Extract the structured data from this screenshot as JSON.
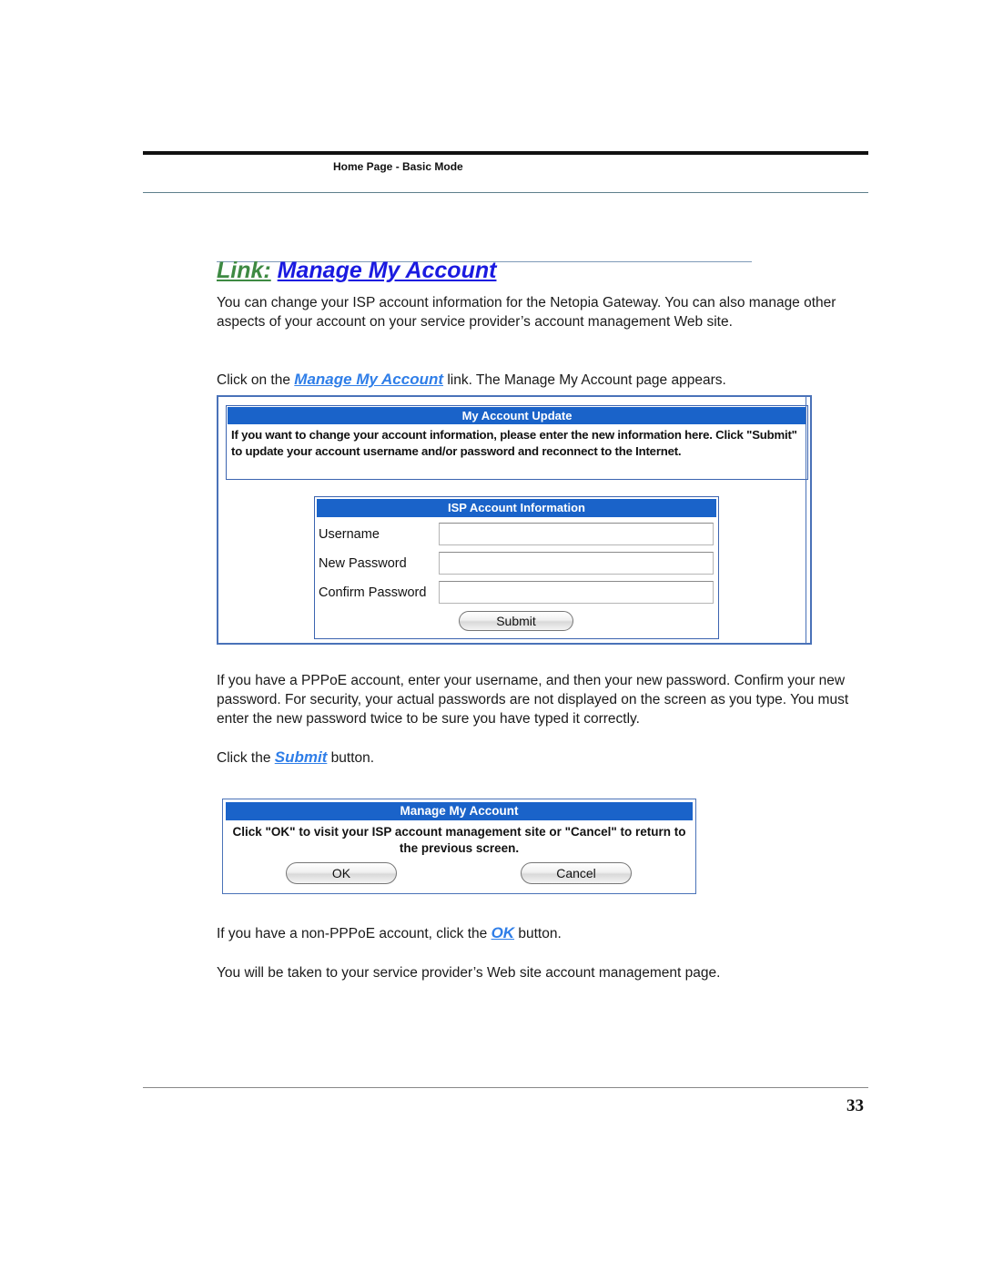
{
  "header": {
    "running_title": "Home Page - Basic Mode"
  },
  "section": {
    "label": "Link:",
    "title_link": "Manage My Account"
  },
  "paragraphs": {
    "intro": "You can change your ISP account information for the Netopia Gateway. You can also manage other aspects of your account on your service provider’s account management Web site.",
    "click_on_prefix": "Click on the ",
    "click_on_link": "Manage My Account",
    "click_on_suffix": " link. The Manage My Account page appears.",
    "pppoe": "If you have a PPPoE account, enter your username, and then your new password. Confirm your new password. For security, your actual passwords are not displayed on the screen as you type. You must enter the new password twice to be sure you have typed it correctly.",
    "click_submit_prefix": "Click the ",
    "click_submit_link": "Submit",
    "click_submit_suffix": " button.",
    "non_pppoe_prefix": "If you have a non-PPPoE account, click the ",
    "non_pppoe_link": "OK",
    "non_pppoe_suffix": " button.",
    "taken_to": "You will be taken to your service provider’s Web site account management page."
  },
  "account_update_screen": {
    "panel_title": "My Account Update",
    "instructions": "If you want to change your account information, please enter the new information here. Click \"Submit\" to update your account username and/or password and reconnect to the Internet.",
    "isp_panel_title": "ISP Account Information",
    "fields": [
      {
        "label": "Username",
        "value": ""
      },
      {
        "label": "New Password",
        "value": ""
      },
      {
        "label": "Confirm Password",
        "value": ""
      }
    ],
    "submit_label": "Submit"
  },
  "manage_dialog": {
    "title": "Manage My Account",
    "message": "Click \"OK\" to visit your ISP account management site or \"Cancel\" to return to the previous screen.",
    "ok_label": "OK",
    "cancel_label": "Cancel"
  },
  "footer": {
    "page_number": "33"
  },
  "colors": {
    "panel_header_blue": "#1a63c9",
    "link_blue": "#1a1ae0",
    "inline_link_blue": "#2f7ee8",
    "label_green": "#3e8a43"
  }
}
